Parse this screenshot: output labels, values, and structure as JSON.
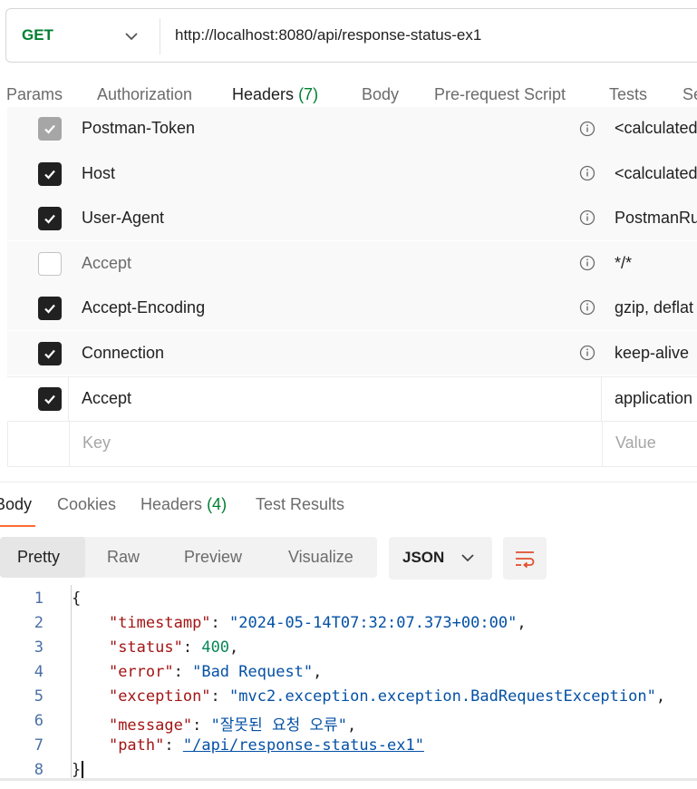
{
  "request": {
    "method": "GET",
    "url": "http://localhost:8080/api/response-status-ex1"
  },
  "request_tabs": [
    {
      "label": "Params"
    },
    {
      "label": "Authorization"
    },
    {
      "label": "Headers",
      "count": "(7)",
      "active": true
    },
    {
      "label": "Body"
    },
    {
      "label": "Pre-request Script"
    },
    {
      "label": "Tests"
    },
    {
      "label": "Se"
    }
  ],
  "headers": [
    {
      "key": "Postman-Token",
      "value": "<calculated",
      "state": "disabled"
    },
    {
      "key": "Host",
      "value": "<calculated",
      "state": "checked"
    },
    {
      "key": "User-Agent",
      "value": "PostmanRu",
      "state": "checked"
    },
    {
      "key": "Accept",
      "value": "*/*",
      "state": "unchecked"
    },
    {
      "key": "Accept-Encoding",
      "value": "gzip, deflat",
      "state": "checked"
    },
    {
      "key": "Connection",
      "value": "keep-alive",
      "state": "checked"
    },
    {
      "key": "Accept",
      "value": "application",
      "state": "checked"
    }
  ],
  "new_header": {
    "key_placeholder": "Key",
    "value_placeholder": "Value"
  },
  "response_tabs": [
    {
      "label": "Body",
      "active": true
    },
    {
      "label": "Cookies"
    },
    {
      "label": "Headers",
      "count": "(4)"
    },
    {
      "label": "Test Results"
    }
  ],
  "view_modes": [
    "Pretty",
    "Raw",
    "Preview",
    "Visualize"
  ],
  "format": "JSON",
  "icons": {
    "method_dropdown": "chevron-down-icon",
    "info": "info-icon",
    "wrap": "wrap-lines-icon"
  },
  "colors": {
    "method": "#007f31",
    "accent": "#ff6c37",
    "json_key": "#a31515",
    "json_string": "#0451a5",
    "json_number": "#098658"
  },
  "response_body": {
    "line_numbers": [
      "1",
      "2",
      "3",
      "4",
      "5",
      "6",
      "7",
      "8"
    ],
    "open_brace": "{",
    "close_brace": "}",
    "fields": [
      {
        "key": "\"timestamp\"",
        "value": "\"2024-05-14T07:32:07.373+00:00\"",
        "type": "string"
      },
      {
        "key": "\"status\"",
        "value": "400",
        "type": "number"
      },
      {
        "key": "\"error\"",
        "value": "\"Bad Request\"",
        "type": "string"
      },
      {
        "key": "\"exception\"",
        "value": "\"mvc2.exception.exception.BadRequestException\"",
        "type": "string"
      },
      {
        "key": "\"message\"",
        "value": "\"잘못된 요청 오류\"",
        "type": "string"
      },
      {
        "key": "\"path\"",
        "value": "\"/api/response-status-ex1\"",
        "type": "link"
      }
    ]
  }
}
